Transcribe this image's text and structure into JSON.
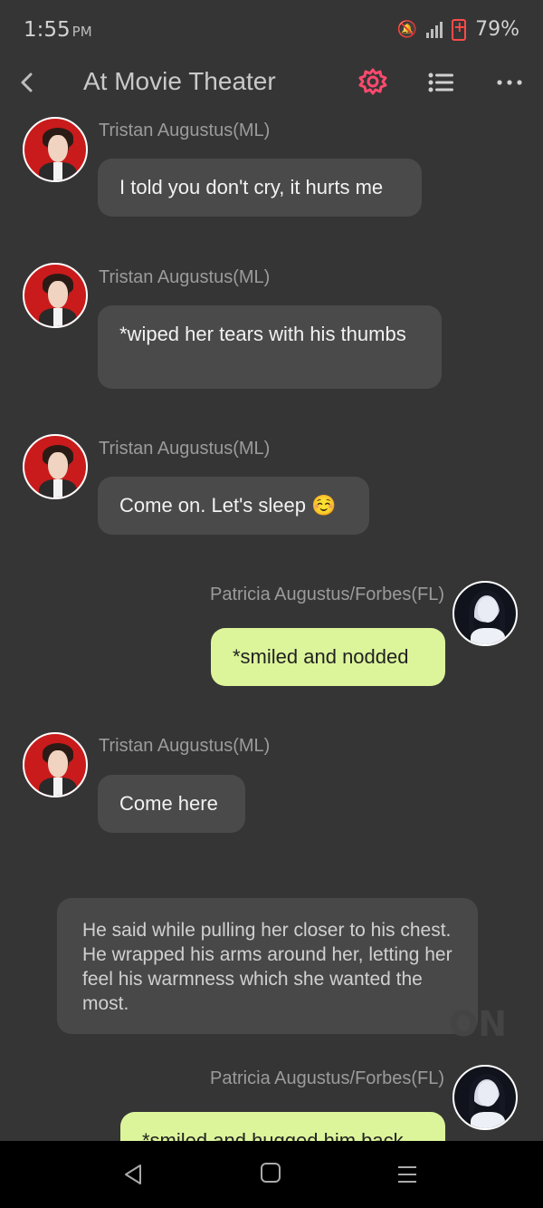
{
  "status": {
    "time": "1:55",
    "ampm": "PM",
    "battery": "79%"
  },
  "header": {
    "title": "At Movie Theater",
    "accent_color": "#ff4a6e"
  },
  "messages": [
    {
      "sender": "Tristan Augustus(ML)",
      "text": "I told you don't cry, it hurts me"
    },
    {
      "sender": "Tristan Augustus(ML)",
      "text": "*wiped her tears with his thumbs"
    },
    {
      "sender": "Tristan Augustus(ML)",
      "text": "Come on. Let's sleep ☺️"
    },
    {
      "sender": "Patricia Augustus/Forbes(FL)",
      "text": "*smiled and nodded"
    },
    {
      "sender": "Tristan Augustus(ML)",
      "text": "Come here"
    },
    {
      "narration": "He said while pulling her closer to his chest. He wrapped his arms around her, letting her feel his warmness which she wanted the most."
    },
    {
      "sender": "Patricia Augustus/Forbes(FL)",
      "text": "*smiled and hugged him back"
    }
  ],
  "watermark": "ON",
  "colors": {
    "background": "#353535",
    "incoming_bubble": "#4a4a4a",
    "outgoing_bubble": "#dcf59a"
  }
}
